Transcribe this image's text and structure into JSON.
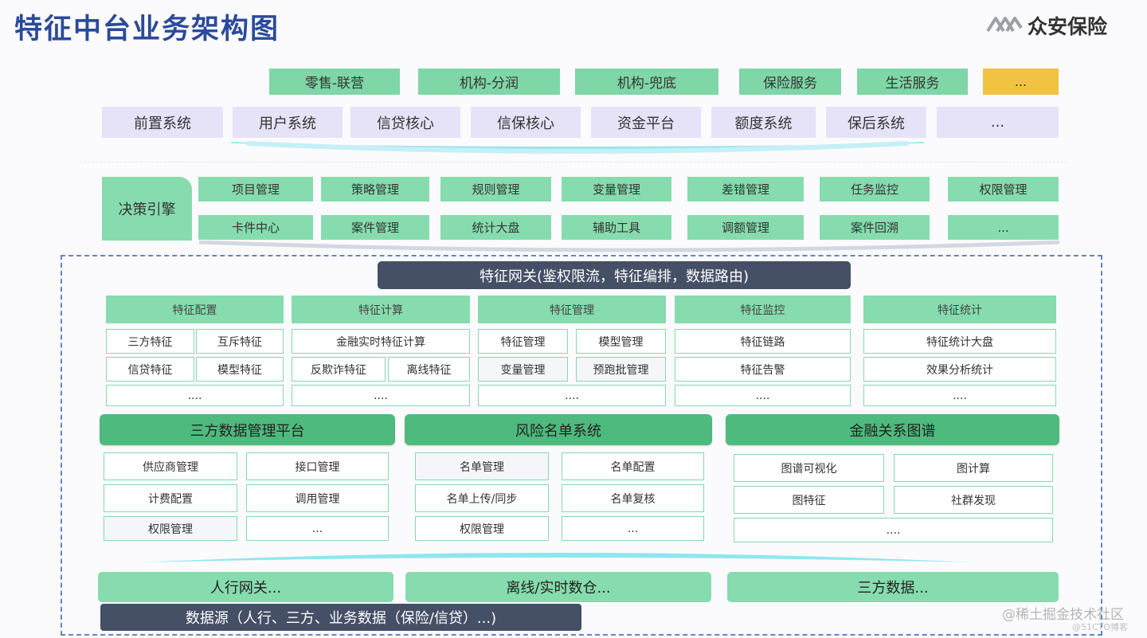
{
  "title": "特征中台业务架构图",
  "logo": {
    "text": "众安保险",
    "icon": "zhongan-logo-icon"
  },
  "business_row": [
    "零售-联营",
    "机构-分润",
    "机构-兜底",
    "保险服务",
    "生活服务",
    "..."
  ],
  "systems_row": [
    "前置系统",
    "用户系统",
    "信贷核心",
    "信保核心",
    "资金平台",
    "额度系统",
    "保后系统",
    "..."
  ],
  "decision": {
    "label": "决策引擎",
    "row1": [
      "项目管理",
      "策略管理",
      "规则管理",
      "变量管理",
      "差错管理",
      "任务监控",
      "权限管理"
    ],
    "row2": [
      "卡件中心",
      "案件管理",
      "统计大盘",
      "辅助工具",
      "调额管理",
      "案件回溯",
      "..."
    ]
  },
  "gateway": "特征网关(鉴权限流，特征编排，数据路由)",
  "modules": [
    {
      "head": "特征配置",
      "cells": [
        "三方特征",
        "互斥特征",
        "信贷特征",
        "模型特征",
        "...."
      ]
    },
    {
      "head": "特征计算",
      "cells": [
        "金融实时特征计算",
        "反欺诈特征",
        "离线特征",
        "...."
      ]
    },
    {
      "head": "特征管理",
      "cells": [
        "特征管理",
        "模型管理",
        "变量管理",
        "预跑批管理",
        "...."
      ]
    },
    {
      "head": "特征监控",
      "cells": [
        "特征链路",
        "特征告警",
        "...."
      ]
    },
    {
      "head": "特征统计",
      "cells": [
        "特征统计大盘",
        "效果分析统计",
        "...."
      ]
    }
  ],
  "platforms": [
    {
      "title": "三方数据管理平台",
      "cells": [
        "供应商管理",
        "接口管理",
        "计费配置",
        "调用管理",
        "权限管理",
        "..."
      ]
    },
    {
      "title": "风险名单系统",
      "cells": [
        "名单管理",
        "名单配置",
        "名单上传/同步",
        "名单复核",
        "权限管理",
        "..."
      ]
    },
    {
      "title": "金融关系图谱",
      "cells": [
        "图谱可视化",
        "图计算",
        "图特征",
        "社群发现",
        "...."
      ]
    }
  ],
  "sources": [
    "人行网关...",
    "离线/实时数仓...",
    "三方数据..."
  ],
  "datasource": "数据源（人行、三方、业务数据（保险/信贷）...)",
  "watermark": "@稀土掘金技术社区",
  "watermark2": "@51CTO博客",
  "colors": {
    "title": "#2b4a9b",
    "green": "#86dcae",
    "dark_green": "#4eba7d",
    "dark": "#454f66",
    "lavender": "#e6e2f8",
    "yellow": "#f2c242",
    "dashed": "#5b87c8"
  }
}
